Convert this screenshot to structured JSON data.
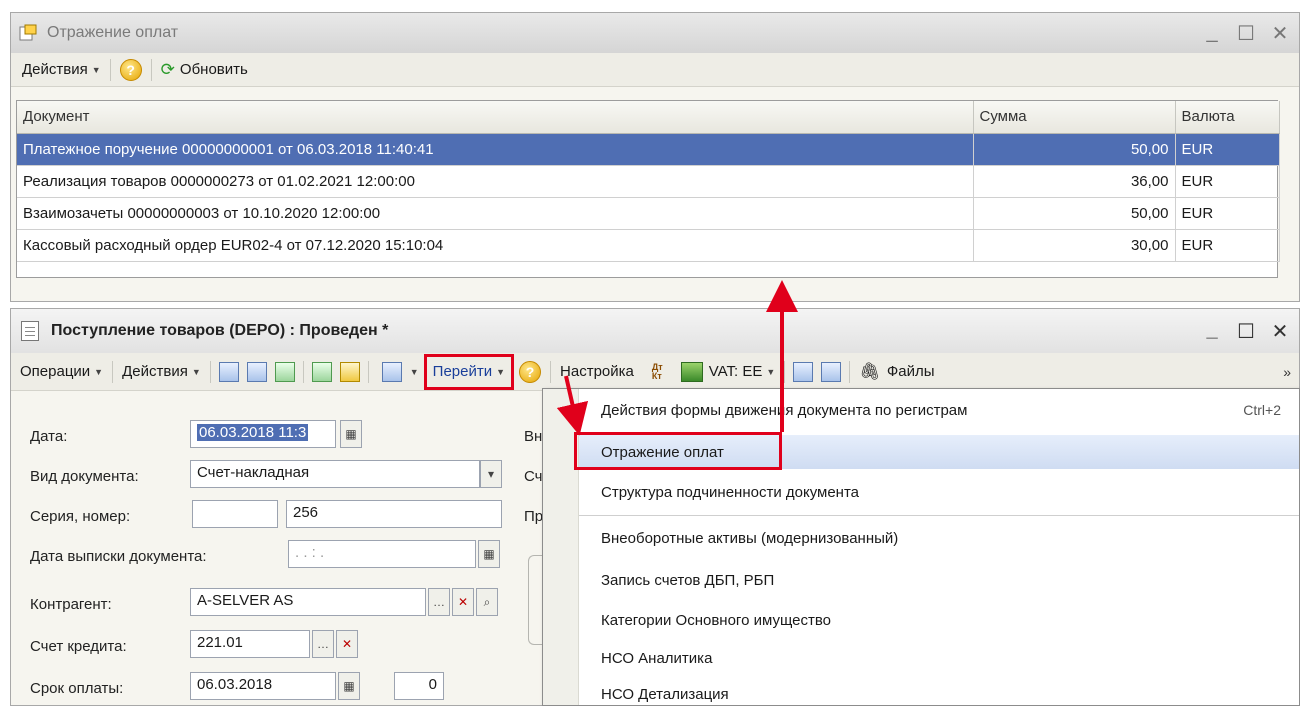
{
  "window_payments": {
    "title": "Отражение оплат",
    "toolbar": {
      "actions": "Действия",
      "help": "?",
      "refresh": "Обновить"
    },
    "table": {
      "headers": [
        "Документ",
        "Сумма",
        "Валюта"
      ],
      "rows": [
        {
          "doc": "Платежное поручение 00000000001 от 06.03.2018 11:40:41",
          "sum": "50,00",
          "cur": "EUR"
        },
        {
          "doc": "Реализация товаров 0000000273 от 01.02.2021 12:00:00",
          "sum": "36,00",
          "cur": "EUR"
        },
        {
          "doc": "Взаимозачеты 00000000003 от 10.10.2020 12:00:00",
          "sum": "50,00",
          "cur": "EUR"
        },
        {
          "doc": "Кассовый расходный ордер EUR02-4 от 07.12.2020 15:10:04",
          "sum": "30,00",
          "cur": "EUR"
        }
      ]
    }
  },
  "window_receipt": {
    "title": "Поступление товаров (DEPO) : Проведен *",
    "toolbar": {
      "operations": "Операции",
      "actions": "Действия",
      "goto": "Перейти",
      "help": "?",
      "settings": "Настройка",
      "dtkt_top": "Дт",
      "dtkt_bottom": "Кт",
      "vat": "VAT: EE",
      "files": "Файлы",
      "more": "»"
    },
    "form": {
      "date_label": "Дата:",
      "date_value": "06.03.2018 11:3",
      "doctype_label": "Вид документа:",
      "doctype_value": "Счет-накладная",
      "series_label": "Серия, номер:",
      "series_value": "",
      "number_value": "256",
      "docdate_label": "Дата выписки документа:",
      "docdate_value": ". . : .",
      "contractor_label": "Контрагент:",
      "contractor_value": "A-SELVER AS",
      "account_label": "Счет кредита:",
      "account_value": "221.01",
      "due_label": "Срок оплаты:",
      "due_value": "06.03.2018",
      "due_days": "0",
      "right_cut_1": "Вн",
      "right_cut_2": "Сч",
      "right_cut_3": "Пр"
    }
  },
  "goto_menu": {
    "items": [
      {
        "label": "Действия формы движения документа по регистрам",
        "shortcut": "Ctrl+2"
      },
      {
        "label": "Отражение оплат",
        "shortcut": ""
      },
      {
        "label": "Структура подчиненности документа",
        "shortcut": ""
      },
      {
        "label": "Внеоборотные активы (модернизованный)",
        "shortcut": ""
      },
      {
        "label": "Запись счетов ДБП, РБП",
        "shortcut": ""
      },
      {
        "label": "Категории Основного имущество",
        "shortcut": ""
      },
      {
        "label": "НСО Аналитика",
        "shortcut": ""
      },
      {
        "label": "НСО Детализация",
        "shortcut": ""
      }
    ]
  },
  "colors": {
    "selection": "#4f6eb3",
    "annotation": "#e0001b"
  }
}
